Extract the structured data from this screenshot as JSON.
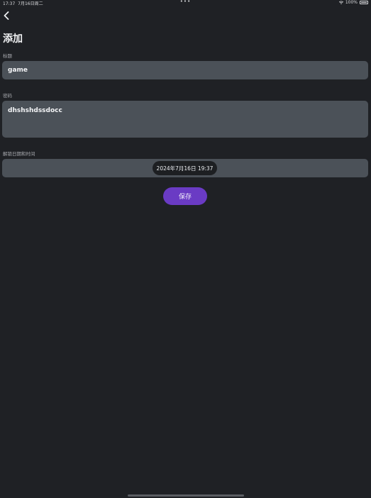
{
  "status_bar": {
    "time": "17:37",
    "date": "7月16日周二",
    "dots": "•••",
    "battery": "100%"
  },
  "header": {
    "title": "添加"
  },
  "form": {
    "title_label": "标题",
    "title_value": "game",
    "password_label": "密码",
    "password_value": "dhshshdssdocc",
    "datetime_label": "解锁日期和时间",
    "datetime_value": "2024年7月16日 19:37"
  },
  "actions": {
    "save_label": "保存"
  },
  "colors": {
    "background": "#1f2125",
    "field": "#4b5158",
    "accent": "#6a3bc4"
  }
}
